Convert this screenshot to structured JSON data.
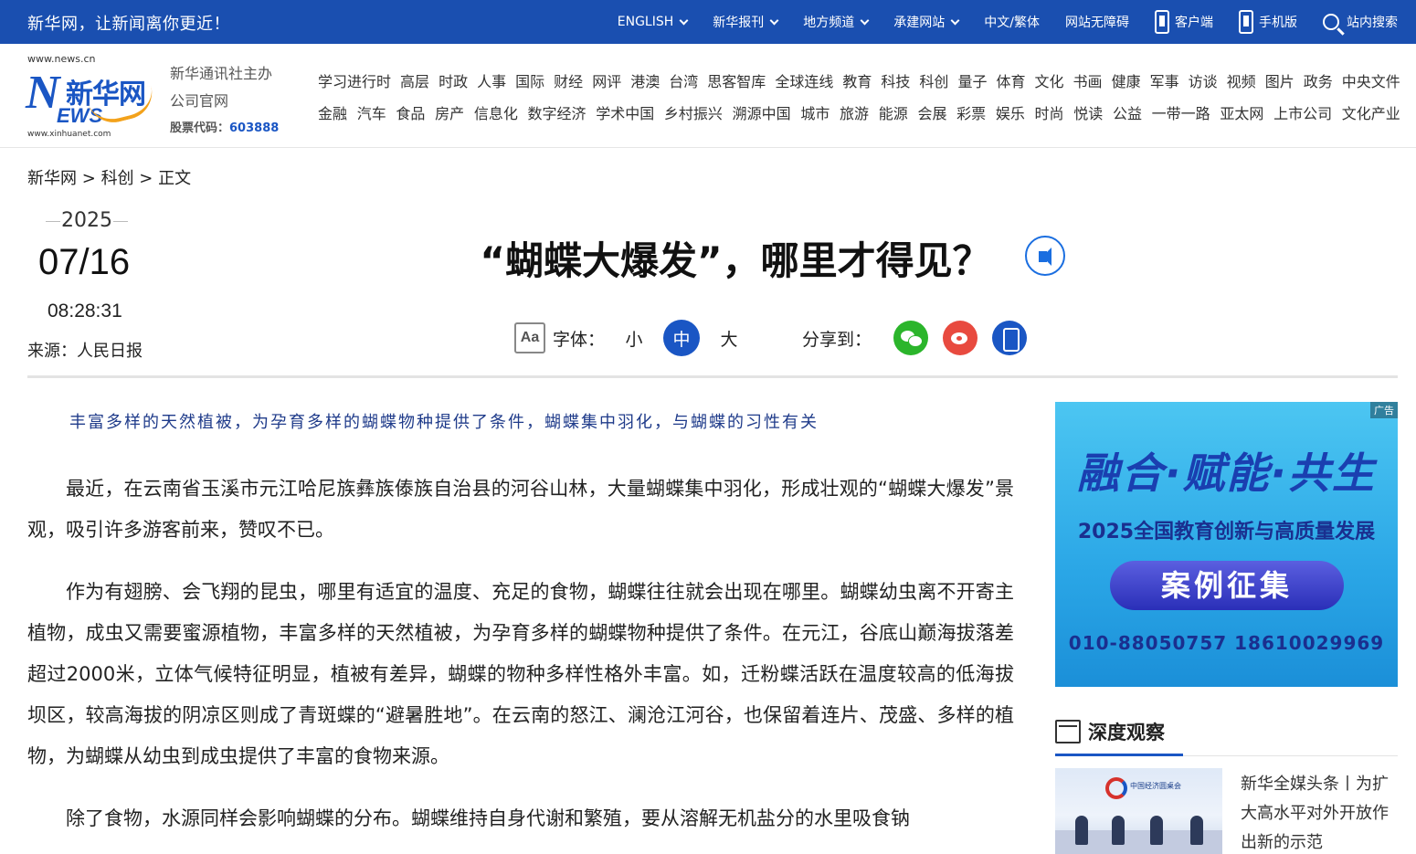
{
  "topbar": {
    "slogan": "新华网，让新闻离你更近！",
    "nav": [
      {
        "label": "ENGLISH",
        "dropdown": true
      },
      {
        "label": "新华报刊",
        "dropdown": true
      },
      {
        "label": "地方频道",
        "dropdown": true
      },
      {
        "label": "承建网站",
        "dropdown": true
      },
      {
        "label": "中文/繁体",
        "dropdown": false
      },
      {
        "label": "网站无障碍",
        "dropdown": false
      }
    ],
    "client_label": "客户端",
    "mobile_label": "手机版",
    "search_label": "站内搜索"
  },
  "header": {
    "logo": {
      "url_top": "www.news.cn",
      "brand_cn": "新华网",
      "letter_n": "N",
      "letters_ews": "EWS",
      "url_bottom": "www.xinhuanet.com"
    },
    "org_line1": "新华通讯社主办",
    "org_line2": "公司官网",
    "stock_label": "股票代码：",
    "stock_code": "603888",
    "channels_row1": [
      "学习进行时",
      "高层",
      "时政",
      "人事",
      "国际",
      "财经",
      "网评",
      "港澳",
      "台湾",
      "思客智库",
      "全球连线",
      "教育",
      "科技",
      "科创",
      "量子",
      "体育",
      "文化",
      "书画",
      "健康",
      "军事",
      "访谈",
      "视频",
      "图片",
      "政务",
      "中央文件"
    ],
    "channels_row2": [
      "金融",
      "汽车",
      "食品",
      "房产",
      "信息化",
      "数字经济",
      "学术中国",
      "乡村振兴",
      "溯源中国",
      "城市",
      "旅游",
      "能源",
      "会展",
      "彩票",
      "娱乐",
      "时尚",
      "悦读",
      "公益",
      "一带一路",
      "亚太网",
      "上市公司",
      "文化产业"
    ]
  },
  "breadcrumb": {
    "home": "新华网",
    "sep": ">",
    "section": "科创",
    "current": "正文"
  },
  "article_meta": {
    "year": "2025",
    "month_day": "07/16",
    "time": "08:28:31",
    "source": "来源：人民日报"
  },
  "article": {
    "title": "“蝴蝶大爆发”，哪里才得见？",
    "font_label": "字体：",
    "font_sizes": [
      "小",
      "中",
      "大"
    ],
    "font_selected": "中",
    "share_label": "分享到：",
    "share_icons": [
      "wechat-icon",
      "weibo-icon",
      "mobile-icon"
    ],
    "summary": "丰富多样的天然植被，为孕育多样的蝴蝶物种提供了条件，蝴蝶集中羽化，与蝴蝶的习性有关",
    "paragraphs": [
      "最近，在云南省玉溪市元江哈尼族彝族傣族自治县的河谷山林，大量蝴蝶集中羽化，形成壮观的“蝴蝶大爆发”景观，吸引许多游客前来，赞叹不已。",
      "作为有翅膀、会飞翔的昆虫，哪里有适宜的温度、充足的食物，蝴蝶往往就会出现在哪里。蝴蝶幼虫离不开寄主植物，成虫又需要蜜源植物，丰富多样的天然植被，为孕育多样的蝴蝶物种提供了条件。在元江，谷底山巅海拔落差超过2000米，立体气候特征明显，植被有差异，蝴蝶的物种多样性格外丰富。如，迁粉蝶活跃在温度较高的低海拔坝区，较高海拔的阴凉区则成了青斑蝶的“避暑胜地”。在云南的怒江、澜沧江河谷，也保留着连片、茂盛、多样的植物，为蝴蝶从幼虫到成虫提供了丰富的食物来源。",
      "除了食物，水源同样会影响蝴蝶的分布。蝴蝶维持自身代谢和繁殖，要从溶解无机盐分的水里吸食钠"
    ]
  },
  "sidebar": {
    "ad": {
      "tag": "广告",
      "title": "融合·赋能·共生",
      "subtitle": "2025全国教育创新与高质量发展",
      "button": "案例征集",
      "phones": "010-88050757  18610029969"
    },
    "deep": {
      "title": "深度观察",
      "item_text": "新华全媒头条丨为扩大高水平对外开放作出新的示范",
      "thumb_caption": "中国经济圆桌会"
    }
  },
  "colors": {
    "brand_blue": "#1a4fb0",
    "summary_blue": "#1f3b8a",
    "wechat_green": "#2bb52b",
    "weibo_red": "#e84a3f"
  }
}
